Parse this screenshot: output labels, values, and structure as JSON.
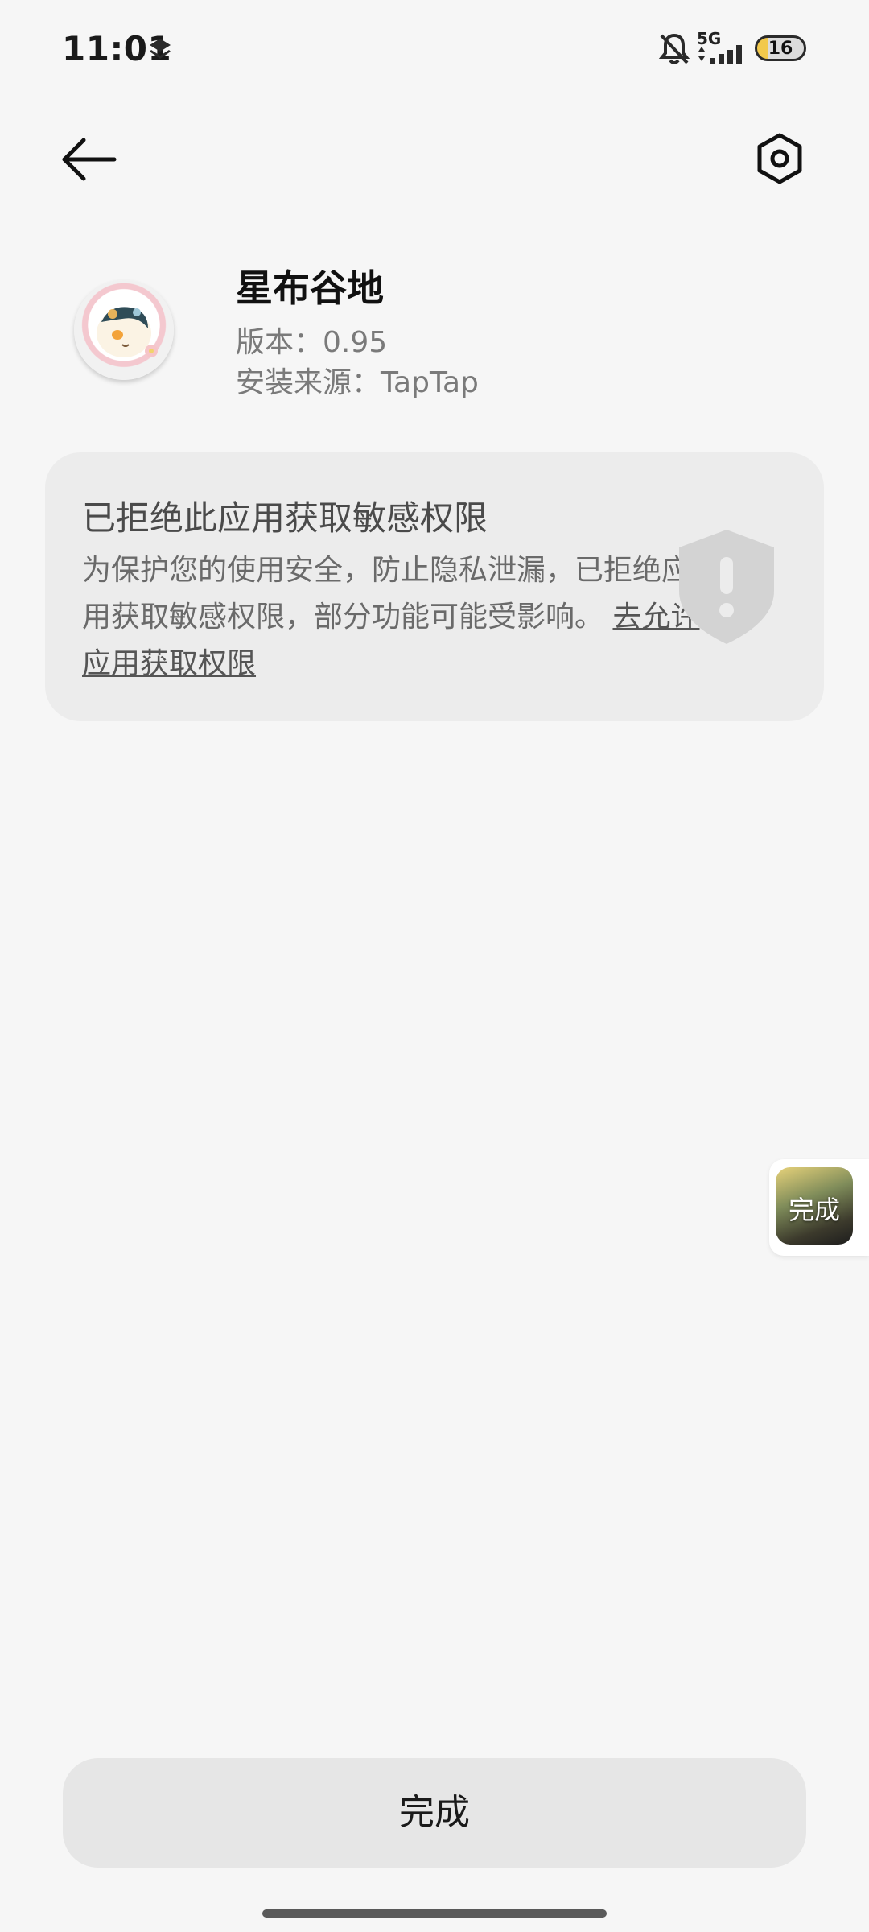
{
  "status_bar": {
    "time": "11:01",
    "network": "5G",
    "battery": "16"
  },
  "top_bar": {
    "back_icon": "arrow-left-icon",
    "settings_icon": "hexagon-settings-icon"
  },
  "app": {
    "name": "星布谷地",
    "version": "版本：0.95",
    "source": "安装来源：TapTap"
  },
  "warning": {
    "title": "已拒绝此应用获取敏感权限",
    "body": "为保护您的使用安全，防止隐私泄漏，已拒绝应用获取敏感权限，部分功能可能受影响。",
    "link": "去允许应用获取权限",
    "icon": "shield-exclamation-icon"
  },
  "floating_bubble": {
    "label": "完成"
  },
  "done_button": {
    "label": "完成"
  }
}
